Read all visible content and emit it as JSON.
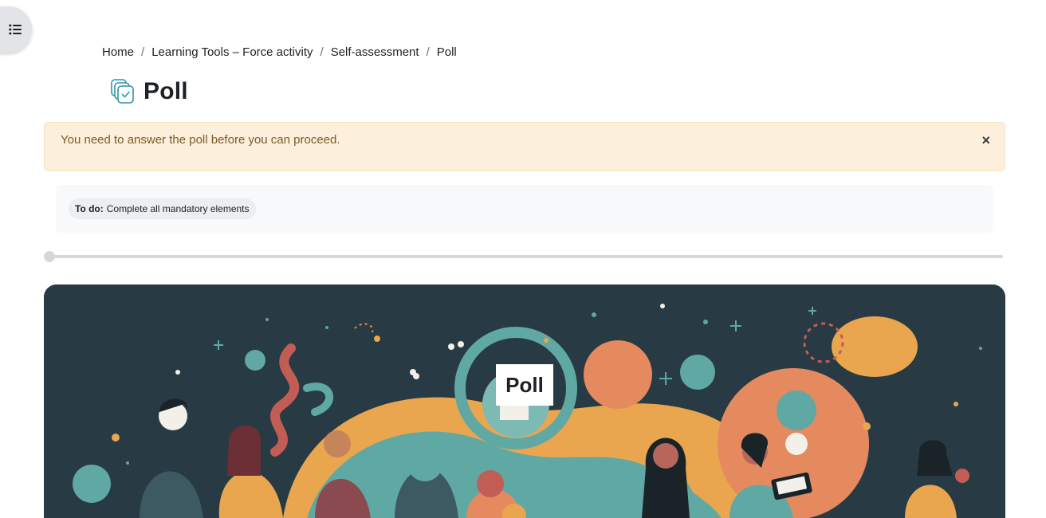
{
  "drawer": {
    "icon": "list-icon"
  },
  "breadcrumb": {
    "items": [
      "Home",
      "Learning Tools – Force activity",
      "Self-assessment",
      "Poll"
    ],
    "separator": "/"
  },
  "page": {
    "title": "Poll",
    "icon": "poll-activity-icon",
    "icon_color": "#2a94a8"
  },
  "alert": {
    "message": "You need to answer the poll before you can proceed.",
    "close_label": "×",
    "color": "#fcefdc"
  },
  "completion": {
    "label": "To do:",
    "text": "Complete all mandatory elements"
  },
  "progress": {
    "value": 0
  },
  "hero": {
    "title": "Poll",
    "background": "#283a44",
    "accent": "#e58a5f",
    "teal": "#5fa8a4",
    "mustard": "#eaa64e"
  }
}
